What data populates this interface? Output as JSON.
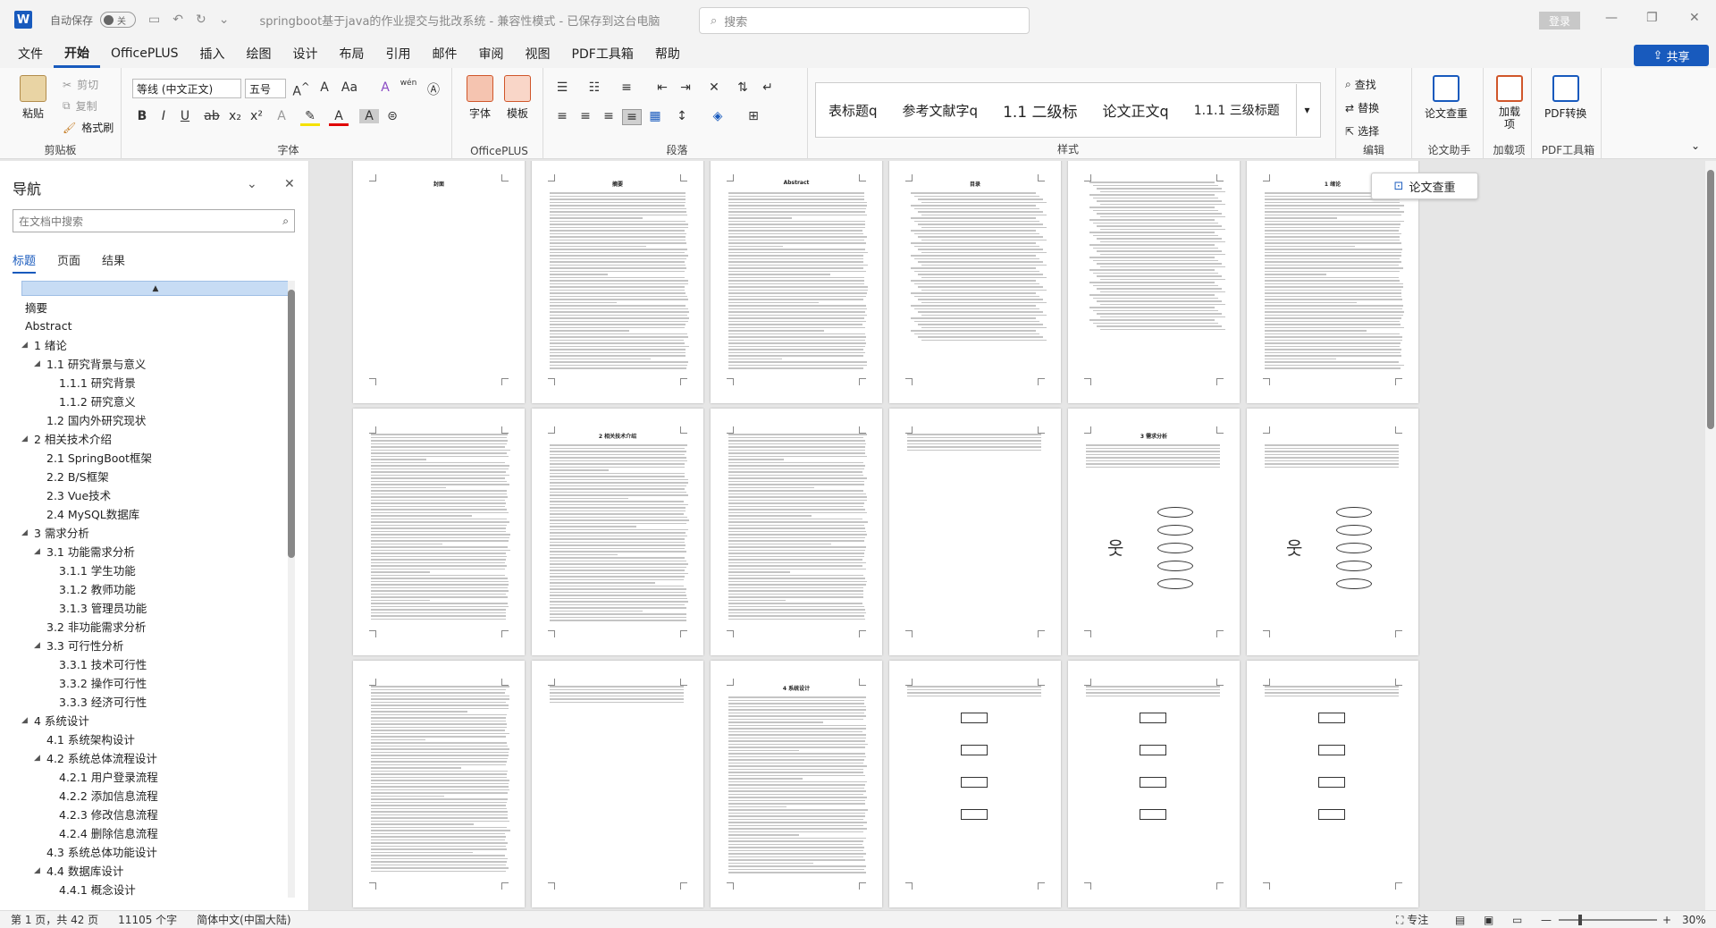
{
  "titlebar": {
    "app_icon": "W",
    "autosave_label": "自动保存",
    "autosave_state": "关",
    "doc_title": "springboot基于java的作业提交与批改系统 - 兼容性模式 - 已保存到这台电脑",
    "search_placeholder": "搜索",
    "login_label": "登录",
    "window_controls": [
      "minimize-icon",
      "restore-icon",
      "close-icon"
    ]
  },
  "menu": {
    "items": [
      "文件",
      "开始",
      "OfficePLUS",
      "插入",
      "绘图",
      "设计",
      "布局",
      "引用",
      "邮件",
      "审阅",
      "视图",
      "PDF工具箱",
      "帮助"
    ],
    "active": "开始",
    "share_label": "共享"
  },
  "ribbon": {
    "clipboard": {
      "paste": "粘贴",
      "cut": "剪切",
      "copy": "复制",
      "format_painter": "格式刷",
      "label": "剪贴板"
    },
    "font": {
      "font_name": "等线 (中文正文)",
      "font_size": "五号",
      "label": "字体"
    },
    "officeplus": {
      "font_btn": "字体",
      "template_btn": "模板",
      "label": "OfficePLUS"
    },
    "paragraph": {
      "label": "段落"
    },
    "styles": {
      "items": [
        "表标题q",
        "参考文献字q",
        "1.1 二级标",
        "论文正文q",
        "1.1.1 三级标题"
      ],
      "label": "样式"
    },
    "editing": {
      "find": "查找",
      "replace": "替换",
      "select": "选择",
      "label": "编辑"
    },
    "thesis_check": {
      "btn": "论文查重",
      "label": "论文助手"
    },
    "addin": {
      "btn": "加载项",
      "label": "加载项"
    },
    "pdf": {
      "btn": "PDF转换",
      "label": "PDF工具箱"
    }
  },
  "nav": {
    "title": "导航",
    "search_placeholder": "在文档中搜索",
    "tabs": [
      "标题",
      "页面",
      "结果"
    ],
    "active_tab": "标题",
    "items": [
      {
        "text": "摘要",
        "level": 0,
        "arrow": false
      },
      {
        "text": "Abstract",
        "level": 0,
        "arrow": false
      },
      {
        "text": "1 绪论",
        "level": 0,
        "arrow": true
      },
      {
        "text": "1.1 研究背景与意义",
        "level": 1,
        "arrow": true
      },
      {
        "text": "1.1.1 研究背景",
        "level": 2,
        "arrow": false
      },
      {
        "text": "1.1.2 研究意义",
        "level": 2,
        "arrow": false
      },
      {
        "text": "1.2 国内外研究现状",
        "level": 1,
        "arrow": false
      },
      {
        "text": "2 相关技术介绍",
        "level": 0,
        "arrow": true
      },
      {
        "text": "2.1 SpringBoot框架",
        "level": 1,
        "arrow": false
      },
      {
        "text": "2.2 B/S框架",
        "level": 1,
        "arrow": false
      },
      {
        "text": "2.3 Vue技术",
        "level": 1,
        "arrow": false
      },
      {
        "text": "2.4 MySQL数据库",
        "level": 1,
        "arrow": false
      },
      {
        "text": "3 需求分析",
        "level": 0,
        "arrow": true
      },
      {
        "text": "3.1 功能需求分析",
        "level": 1,
        "arrow": true
      },
      {
        "text": "3.1.1 学生功能",
        "level": 2,
        "arrow": false
      },
      {
        "text": "3.1.2 教师功能",
        "level": 2,
        "arrow": false
      },
      {
        "text": "3.1.3 管理员功能",
        "level": 2,
        "arrow": false
      },
      {
        "text": "3.2 非功能需求分析",
        "level": 1,
        "arrow": false
      },
      {
        "text": "3.3 可行性分析",
        "level": 1,
        "arrow": true
      },
      {
        "text": "3.3.1 技术可行性",
        "level": 2,
        "arrow": false
      },
      {
        "text": "3.3.2 操作可行性",
        "level": 2,
        "arrow": false
      },
      {
        "text": "3.3.3 经济可行性",
        "level": 2,
        "arrow": false
      },
      {
        "text": "4 系统设计",
        "level": 0,
        "arrow": true
      },
      {
        "text": "4.1 系统架构设计",
        "level": 1,
        "arrow": false
      },
      {
        "text": "4.2 系统总体流程设计",
        "level": 1,
        "arrow": true
      },
      {
        "text": "4.2.1 用户登录流程",
        "level": 2,
        "arrow": false
      },
      {
        "text": "4.2.2 添加信息流程",
        "level": 2,
        "arrow": false
      },
      {
        "text": "4.2.3 修改信息流程",
        "level": 2,
        "arrow": false
      },
      {
        "text": "4.2.4 删除信息流程",
        "level": 2,
        "arrow": false
      },
      {
        "text": "4.3 系统总体功能设计",
        "level": 1,
        "arrow": false
      },
      {
        "text": "4.4 数据库设计",
        "level": 1,
        "arrow": true
      },
      {
        "text": "4.4.1 概念设计",
        "level": 2,
        "arrow": false
      }
    ]
  },
  "document": {
    "floating_button": "论文查重",
    "pages": [
      {
        "title": "封面",
        "kind": "cover"
      },
      {
        "title": "摘要",
        "kind": "text"
      },
      {
        "title": "Abstract",
        "kind": "text"
      },
      {
        "title": "目录",
        "kind": "toc"
      },
      {
        "title": "",
        "kind": "toc"
      },
      {
        "title": "1 绪论",
        "kind": "text"
      },
      {
        "title": "",
        "kind": "text"
      },
      {
        "title": "2 相关技术介绍",
        "kind": "text"
      },
      {
        "title": "",
        "kind": "text"
      },
      {
        "title": "",
        "kind": "short"
      },
      {
        "title": "3 需求分析",
        "kind": "diagram"
      },
      {
        "title": "",
        "kind": "diagram"
      },
      {
        "title": "",
        "kind": "text"
      },
      {
        "title": "",
        "kind": "short"
      },
      {
        "title": "4 系统设计",
        "kind": "text"
      },
      {
        "title": "",
        "kind": "flow"
      },
      {
        "title": "",
        "kind": "flow"
      },
      {
        "title": "",
        "kind": "flow"
      }
    ]
  },
  "status": {
    "page": "第 1 页，共 42 页",
    "words": "11105 个字",
    "language": "简体中文(中国大陆)",
    "focus": "专注",
    "zoom": "30%"
  }
}
